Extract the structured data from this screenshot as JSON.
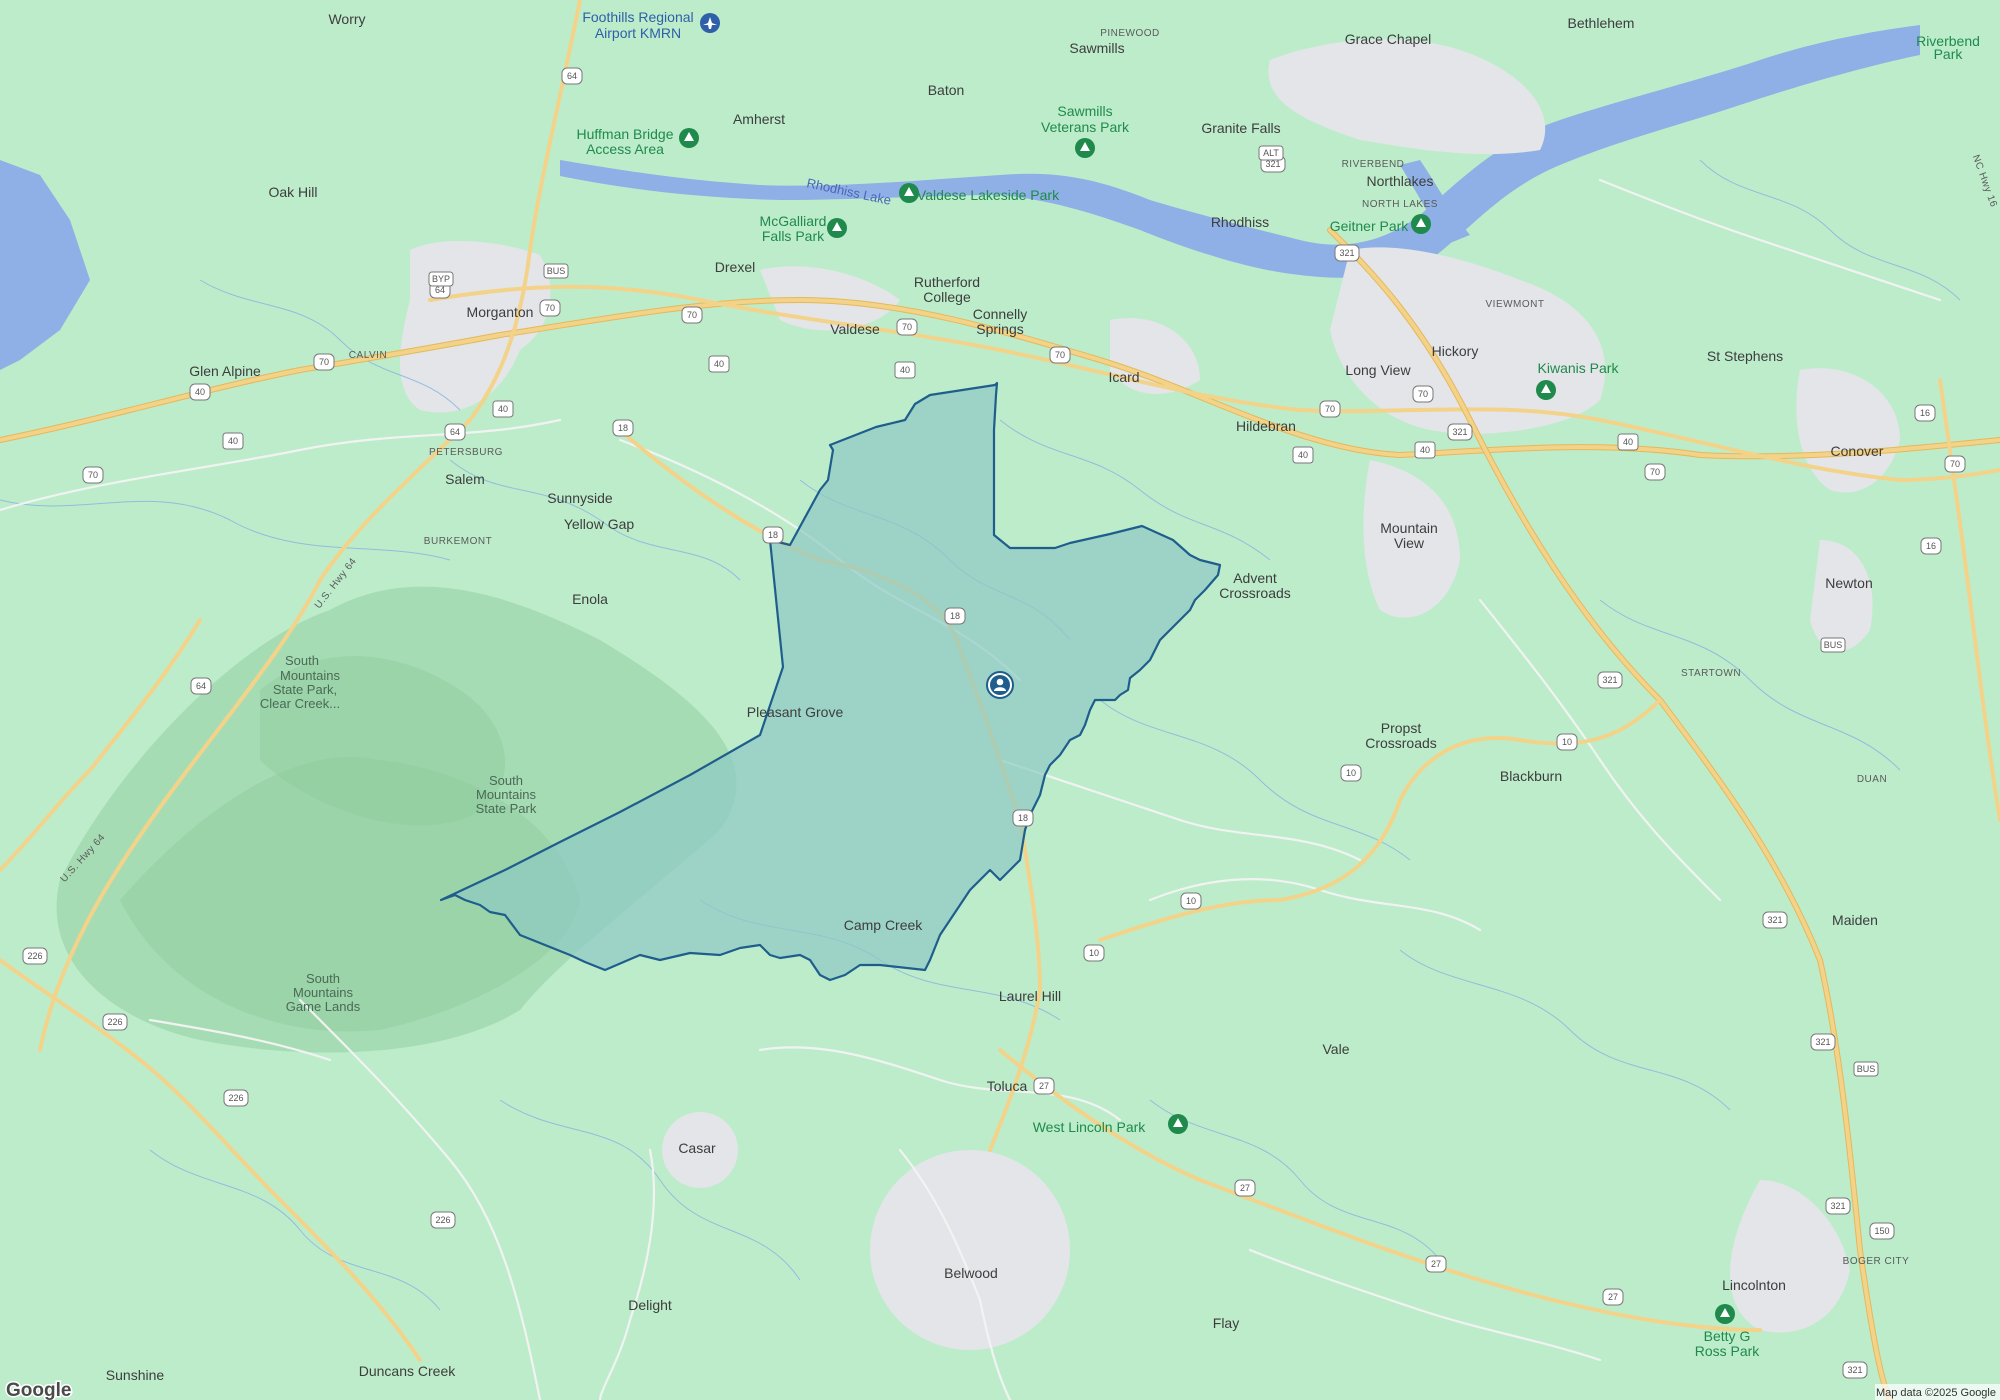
{
  "map": {
    "provider_logo": "Google",
    "attribution": "Map data ©2025 Google",
    "boundary_fill": "#8ec9c3",
    "boundary_stroke": "#1f5d8c",
    "center_marker_icon": "person-pin-icon"
  },
  "places": {
    "worry": "Worry",
    "foothills_airport_1": "Foothills Regional",
    "foothills_airport_2": "Airport KMRN",
    "pinewood": "PINEWOOD",
    "sawmills": "Sawmills",
    "grace_chapel": "Grace Chapel",
    "bethlehem": "Bethlehem",
    "riverbend_park_1": "Riverbend",
    "riverbend_park_2": "Park",
    "baton": "Baton",
    "amherst": "Amherst",
    "huffman_1": "Huffman Bridge",
    "huffman_2": "Access Area",
    "sawmills_veterans_1": "Sawmills",
    "sawmills_veterans_2": "Veterans Park",
    "granite_falls": "Granite Falls",
    "riverbend": "RIVERBEND",
    "northlakes": "Northlakes",
    "north_lakes": "NORTH LAKES",
    "rhodhiss_lake": "Rhodhiss Lake",
    "valdese_lakeside_park": "Valdese Lakeside Park",
    "oak_hill": "Oak Hill",
    "mcgalliard_1": "McGalliard",
    "mcgalliard_2": "Falls Park",
    "rhodhiss": "Rhodhiss",
    "geitner_park": "Geitner Park",
    "drexel": "Drexel",
    "rutherford_1": "Rutherford",
    "rutherford_2": "College",
    "viewmont": "VIEWMONT",
    "morganton": "Morganton",
    "connelly_1": "Connelly",
    "connelly_2": "Springs",
    "valdese": "Valdese",
    "hickory": "Hickory",
    "calvin": "CALVIN",
    "st_stephens": "St Stephens",
    "glen_alpine": "Glen Alpine",
    "icard": "Icard",
    "long_view": "Long View",
    "kiwanis_park": "Kiwanis Park",
    "hildebran": "Hildebran",
    "petersburg": "PETERSBURG",
    "conover": "Conover",
    "salem": "Salem",
    "sunnyside": "Sunnyside",
    "burkemont": "BURKEMONT",
    "yellow_gap": "Yellow Gap",
    "mountain_view_1": "Mountain",
    "mountain_view_2": "View",
    "advent_1": "Advent",
    "advent_2": "Crossroads",
    "newton": "Newton",
    "us_hwy_64": "U.S. Hwy 64",
    "enola": "Enola",
    "south_mountains_sp_1": "South",
    "south_mountains_sp_2": "Mountains",
    "south_mountains_sp_3": "State Park,",
    "south_mountains_sp_4": "Clear Creek...",
    "startown": "STARTOWN",
    "pleasant_grove": "Pleasant Grove",
    "propst_1": "Propst",
    "propst_2": "Crossroads",
    "blackburn": "Blackburn",
    "duan": "DUAN",
    "smsp_1": "South",
    "smsp_2": "Mountains",
    "smsp_3": "State Park",
    "us_hwy_64_b": "U.S. Hwy 64",
    "maiden": "Maiden",
    "camp_creek": "Camp Creek",
    "laurel_hill": "Laurel Hill",
    "smgl_1": "South",
    "smgl_2": "Mountains",
    "smgl_3": "Game Lands",
    "vale": "Vale",
    "toluca": "Toluca",
    "west_lincoln_park": "West Lincoln Park",
    "casar": "Casar",
    "boger_city": "BOGER CITY",
    "belwood": "Belwood",
    "lincolnton": "Lincolnton",
    "delight": "Delight",
    "flay": "Flay",
    "betty_ross_1": "Betty G",
    "betty_ross_2": "Ross Park",
    "sunshine": "Sunshine",
    "duncans_creek": "Duncans Creek",
    "nc_hwy_16": "NC Hwy 16"
  },
  "shields": {
    "s64a": "64",
    "s64b": "64",
    "s64c": "64",
    "s64d": "64",
    "s18a": "18",
    "s18b": "18",
    "s18c": "18",
    "s18d": "18",
    "s70a": "70",
    "s70b": "70",
    "s70c": "70",
    "s70d": "70",
    "s70e": "70",
    "s70f": "70",
    "s70g": "70",
    "s70h": "70",
    "s40a": "40",
    "s40b": "40",
    "s40c": "40",
    "s40d": "40",
    "s40e": "40",
    "s40f": "40",
    "s40g": "40",
    "s321a": "321",
    "s321b": "321",
    "s321c": "321",
    "s321d": "321",
    "s321e": "321",
    "s321f": "321",
    "s321g": "321",
    "s321h": "321",
    "s10a": "10",
    "s10b": "10",
    "s10c": "10",
    "s10d": "10",
    "s16a": "16",
    "s16b": "16",
    "s27a": "27",
    "s27b": "27",
    "s27c": "27",
    "s27d": "27",
    "s226a": "226",
    "s226b": "226",
    "s226c": "226",
    "s226d": "226",
    "s150": "150",
    "byp": "BYP",
    "bus_a": "BUS",
    "bus_b": "BUS",
    "bus_c": "BUS",
    "alt": "ALT"
  }
}
